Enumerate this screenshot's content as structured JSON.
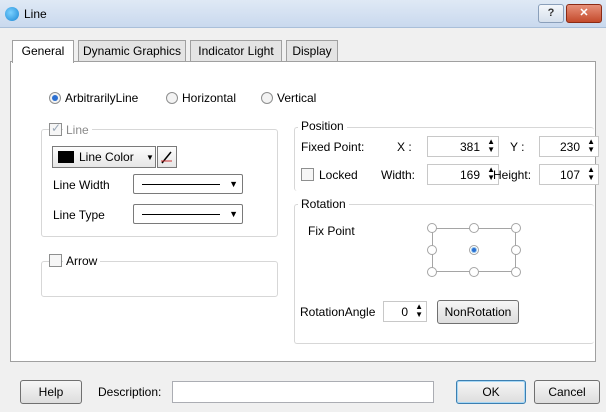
{
  "window": {
    "title": "Line",
    "help_btn": "?",
    "close_btn": "✕"
  },
  "tabs": [
    "General",
    "Dynamic Graphics",
    "Indicator Light",
    "Display"
  ],
  "active_tab": "General",
  "orientation": {
    "options": [
      "ArbitrarilyLine",
      "Horizontal",
      "Vertical"
    ],
    "selected": "ArbitrarilyLine"
  },
  "line_group": {
    "title": "Line",
    "checked": true,
    "color_label": "Line Color",
    "color_value": "#000000",
    "width_label": "Line Width",
    "type_label": "Line Type"
  },
  "arrow_group": {
    "title": "Arrow",
    "checked": false
  },
  "position": {
    "title": "Position",
    "fixed_point_label": "Fixed Point:",
    "x_label": "X :",
    "x_value": "381",
    "y_label": "Y :",
    "y_value": "230",
    "locked_label": "Locked",
    "locked": false,
    "width_label": "Width:",
    "width_value": "169",
    "height_label": "Height:",
    "height_value": "107"
  },
  "rotation": {
    "title": "Rotation",
    "fix_point_label": "Fix Point",
    "selected_point": "center",
    "angle_label": "RotationAngle",
    "angle_value": "0",
    "non_rotation_btn": "NonRotation"
  },
  "footer": {
    "help_btn": "Help",
    "description_label": "Description:",
    "description_value": "",
    "ok_btn": "OK",
    "cancel_btn": "Cancel"
  }
}
